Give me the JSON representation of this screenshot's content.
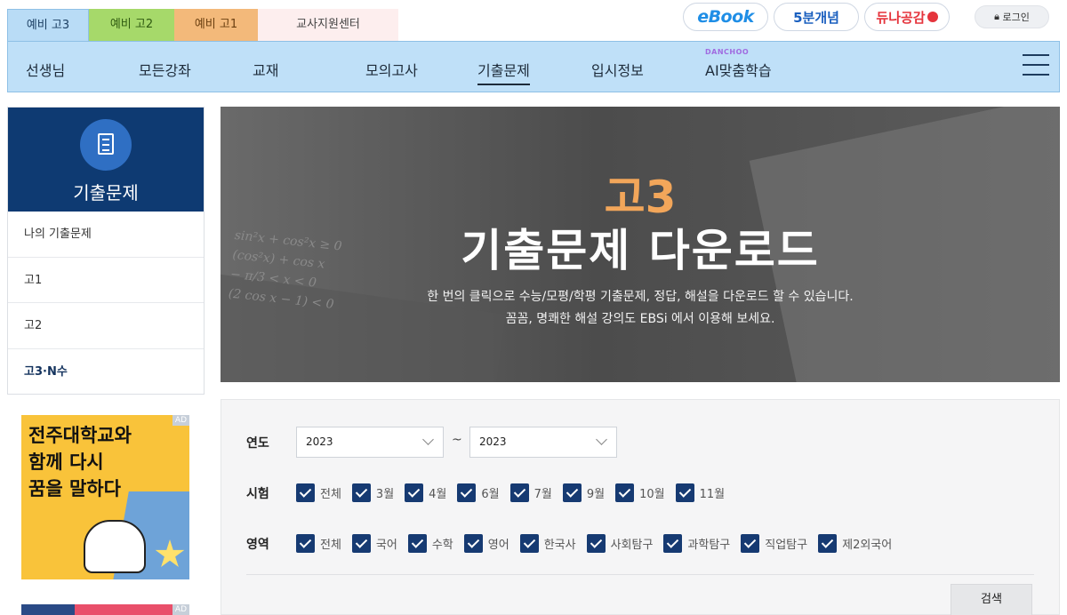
{
  "grade_tabs": [
    "예비 고3",
    "예비 고2",
    "예비 고1",
    "교사지원센터"
  ],
  "top_links": {
    "ebook": "eBook",
    "five_min": "5분개념",
    "dunna": "듀나공감",
    "login": "로그인"
  },
  "nav": {
    "items": [
      "선생님",
      "모든강좌",
      "교재",
      "모의고사",
      "기출문제",
      "입시정보",
      "AI맞춤학습"
    ],
    "active": "기출문제",
    "ai_badge": "DANCHOO"
  },
  "sidebar": {
    "title": "기출문제",
    "items": [
      "나의 기출문제",
      "고1",
      "고2",
      "고3·N수"
    ]
  },
  "ad": {
    "badge": "AD",
    "lines": [
      "전주대학교와",
      "함께 다시",
      "꿈을 말하다"
    ]
  },
  "hero": {
    "grade": "고3",
    "title": "기출문제 다운로드",
    "desc1": "한 번의 클릭으로 수능/모평/학평 기출문제, 정답, 해설을 다운로드 할 수 있습니다.",
    "desc2": "꼼꼼, 명쾌한 해설 강의도 EBSi 에서 이용해 보세요."
  },
  "filter": {
    "year_label": "연도",
    "year_from": "2023",
    "year_to": "2023",
    "tilde": "~",
    "exam_label": "시험",
    "exam_options": [
      "전체",
      "3월",
      "4월",
      "6월",
      "7월",
      "9월",
      "10월",
      "11월"
    ],
    "area_label": "영역",
    "area_options": [
      "전체",
      "국어",
      "수학",
      "영어",
      "한국사",
      "사회탐구",
      "과학탐구",
      "직업탐구",
      "제2외국어"
    ],
    "search_label": "검색"
  }
}
